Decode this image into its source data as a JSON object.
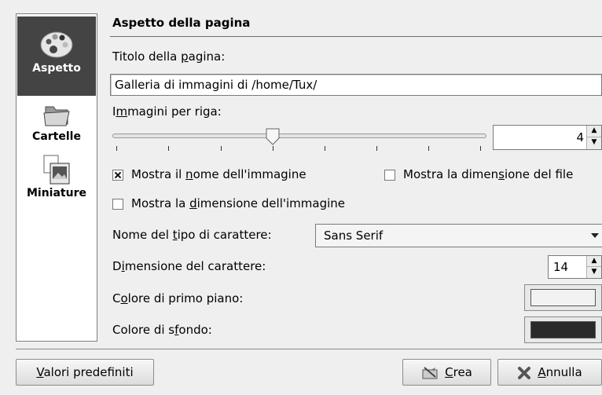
{
  "sidebar": {
    "items": [
      {
        "label": "Aspetto",
        "icon": "palette-icon",
        "selected": true
      },
      {
        "label": "Cartelle",
        "icon": "folder-icon",
        "selected": false
      },
      {
        "label": "Miniature",
        "icon": "image-thumbnail-icon",
        "selected": false
      }
    ]
  },
  "page": {
    "title": "Aspetto della pagina"
  },
  "page_title_field": {
    "label_before": "Titolo della ",
    "label_accel": "p",
    "label_after": "agina:",
    "value": "Galleria di immagini di /home/Tux/"
  },
  "images_per_row": {
    "label_before": "I",
    "label_accel": "m",
    "label_after": "magini per riga:",
    "value": "4",
    "slider_fraction": 0.43
  },
  "show_name": {
    "label_before": "Mostra il ",
    "label_accel": "n",
    "label_after": "ome dell'immagine",
    "checked": true
  },
  "show_file_size": {
    "label_before": "Mostra la dimen",
    "label_accel": "s",
    "label_after": "ione del file",
    "checked": false
  },
  "show_image_size": {
    "label_before": "Mostra la ",
    "label_accel": "d",
    "label_after": "imensione dell'immagine",
    "checked": false
  },
  "font_name": {
    "label_before": "Nome del ",
    "label_accel": "t",
    "label_after": "ipo di carattere:",
    "value": "Sans Serif"
  },
  "font_size": {
    "label_before": "D",
    "label_accel": "i",
    "label_after": "mensione del carattere:",
    "value": "14"
  },
  "foreground_color": {
    "label_before": "C",
    "label_accel": "o",
    "label_after": "lore di primo piano:",
    "color": "#f2f2f2"
  },
  "background_color": {
    "label_before": "Colore di s",
    "label_accel": "f",
    "label_after": "ondo:",
    "color": "#2a2a2a"
  },
  "buttons": {
    "defaults": {
      "accel": "V",
      "rest": "alori predefiniti"
    },
    "create": {
      "accel": "C",
      "rest": "rea"
    },
    "cancel": {
      "accel": "A",
      "rest": "nnulla"
    }
  }
}
